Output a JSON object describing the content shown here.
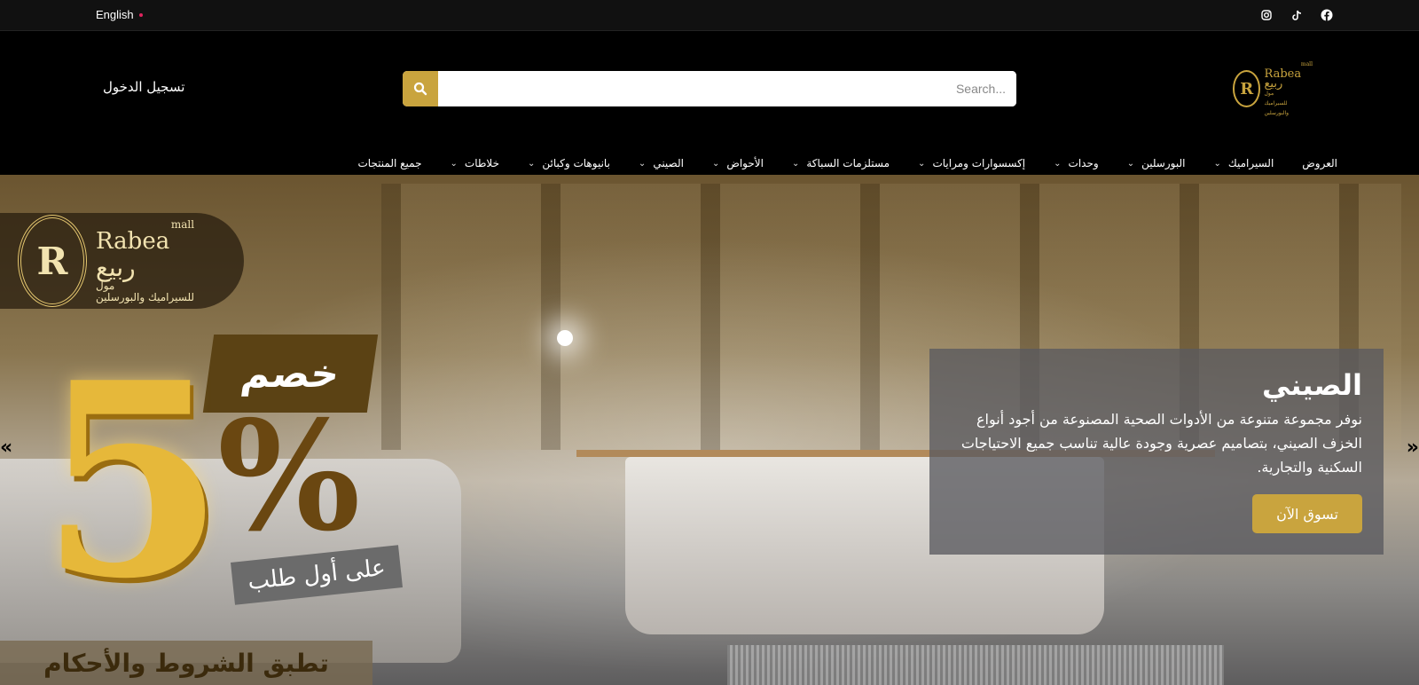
{
  "topbar": {
    "language": "English",
    "socials": [
      "instagram-icon",
      "tiktok-icon",
      "facebook-icon"
    ]
  },
  "header": {
    "login_label": "تسجيل الدخول",
    "search": {
      "placeholder": "Search..."
    },
    "logo": {
      "en": "Rabea",
      "en_suffix": "mall",
      "ar": "ربيع",
      "ar_suffix": "مول",
      "tagline": "للسيراميك والبورسلين"
    }
  },
  "nav": {
    "items": [
      {
        "label": "العروض",
        "dropdown": false
      },
      {
        "label": "السيراميك",
        "dropdown": true
      },
      {
        "label": "البورسلين",
        "dropdown": true
      },
      {
        "label": "وحدات",
        "dropdown": true
      },
      {
        "label": "إكسسوارات ومرايات",
        "dropdown": true
      },
      {
        "label": "مستلزمات السباكة",
        "dropdown": true
      },
      {
        "label": "الأحواض",
        "dropdown": true
      },
      {
        "label": "الصيني",
        "dropdown": true
      },
      {
        "label": "بانيوهات وكبائن",
        "dropdown": true
      },
      {
        "label": "خلاطات",
        "dropdown": true
      },
      {
        "label": "جميع المنتجات",
        "dropdown": false
      }
    ]
  },
  "hero": {
    "promo": {
      "logo_en": "Rabea",
      "logo_en_suffix": "mall",
      "logo_ar": "ربيع",
      "logo_ar_suffix": "مول",
      "logo_tagline": "للسيراميك والبورسلين",
      "discount_word": "خصم",
      "number": "5",
      "percent": "%",
      "first_order": "على أول طلب",
      "terms": "تطبق الشروط والأحكام"
    },
    "caption": {
      "title": "الصيني",
      "text": "نوفر مجموعة متنوعة من الأدوات الصحية المصنوعة من أجود أنواع الخزف الصيني، بتصاميم عصرية وجودة عالية تناسب جميع الاحتياجات السكنية والتجارية.",
      "cta": "تسوق الآن"
    },
    "prev_arrow": "«",
    "next_arrow": "»"
  },
  "colors": {
    "accent": "#c9a43e",
    "topbar": "#111111",
    "header": "#000000"
  }
}
